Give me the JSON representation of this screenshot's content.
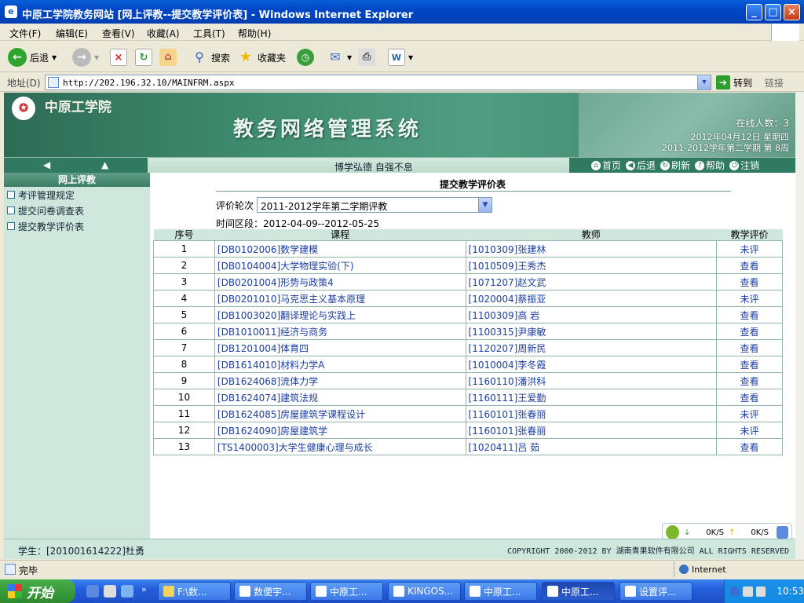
{
  "window": {
    "title": "中原工学院教务网站 [网上评教--提交教学评价表] - Windows Internet Explorer",
    "controls": {
      "minimize": "_",
      "maximize": "□",
      "close": "×"
    }
  },
  "menu": [
    "文件(F)",
    "编辑(E)",
    "查看(V)",
    "收藏(A)",
    "工具(T)",
    "帮助(H)"
  ],
  "toolbar": {
    "back": "后退",
    "search": "搜索",
    "favorites": "收藏夹"
  },
  "address": {
    "label": "地址(D)",
    "url": "http://202.196.32.10/MAINFRM.aspx",
    "go": "转到",
    "links": "链接"
  },
  "banner": {
    "school": "中原工学院",
    "system": "教务网络管理系统",
    "online": "在线人数：3",
    "date": "2012年04月12日  星期四",
    "term": "2011-2012学年第二学期  第 8周"
  },
  "nav": {
    "motto": "博学弘德  自强不息",
    "links": [
      "首页",
      "后退",
      "刷新",
      "帮助",
      "注销"
    ]
  },
  "sidebar": {
    "header": "网上评教",
    "items": [
      "考评管理规定",
      "提交问卷调查表",
      "提交教学评价表"
    ]
  },
  "content": {
    "title": "提交教学评价表",
    "round_label": "评价轮次",
    "round_value": "2011-2012学年第二学期评教",
    "period": "时间区段：2012-04-09--2012-05-25",
    "headers": [
      "序号",
      "课程",
      "教师",
      "教学评价"
    ],
    "rows": [
      {
        "no": "1",
        "course": "[DB0102006]数学建模",
        "teacher": "[1010309]张建林",
        "eval": "未评"
      },
      {
        "no": "2",
        "course": "[DB0104004]大学物理实验(下)",
        "teacher": "[1010509]王秀杰",
        "eval": "查看"
      },
      {
        "no": "3",
        "course": "[DB0201004]形势与政策4",
        "teacher": "[1071207]赵文武",
        "eval": "查看"
      },
      {
        "no": "4",
        "course": "[DB0201010]马克思主义基本原理",
        "teacher": "[1020004]蔡振亚",
        "eval": "未评"
      },
      {
        "no": "5",
        "course": "[DB1003020]翻译理论与实践上",
        "teacher": "[1100309]高  岩",
        "eval": "查看"
      },
      {
        "no": "6",
        "course": "[DB1010011]经济与商务",
        "teacher": "[1100315]尹康敏",
        "eval": "查看"
      },
      {
        "no": "7",
        "course": "[DB1201004]体育四",
        "teacher": "[1120207]周新民",
        "eval": "查看"
      },
      {
        "no": "8",
        "course": "[DB1614010]材料力学A",
        "teacher": "[1010004]李冬霞",
        "eval": "查看"
      },
      {
        "no": "9",
        "course": "[DB1624068]流体力学",
        "teacher": "[1160110]潘洪科",
        "eval": "查看"
      },
      {
        "no": "10",
        "course": "[DB1624074]建筑法规",
        "teacher": "[1160111]王爱勤",
        "eval": "查看"
      },
      {
        "no": "11",
        "course": "[DB1624085]房屋建筑学课程设计",
        "teacher": "[1160101]张春丽",
        "eval": "未评"
      },
      {
        "no": "12",
        "course": "[DB1624090]房屋建筑学",
        "teacher": "[1160101]张春丽",
        "eval": "未评"
      },
      {
        "no": "13",
        "course": "[TS1400003]大学生健康心理与成长",
        "teacher": "[1020411]吕  茹",
        "eval": "查看"
      }
    ]
  },
  "footer": {
    "student": "学生：[201001614222]杜勇",
    "copyright": "COPYRIGHT 2000-2012 BY 湖南青果软件有限公司 ALL RIGHTS RESERVED"
  },
  "speed": {
    "down": "0K/S",
    "up": "0K/S"
  },
  "status": {
    "text": "完毕",
    "zone": "Internet"
  },
  "taskbar": {
    "start": "开始",
    "tasks": [
      "F:\\数...",
      "数便宇...",
      "中原工...",
      "KINGOS...",
      "中原工...",
      "中原工...",
      "设置评..."
    ],
    "clock": "10:53"
  }
}
